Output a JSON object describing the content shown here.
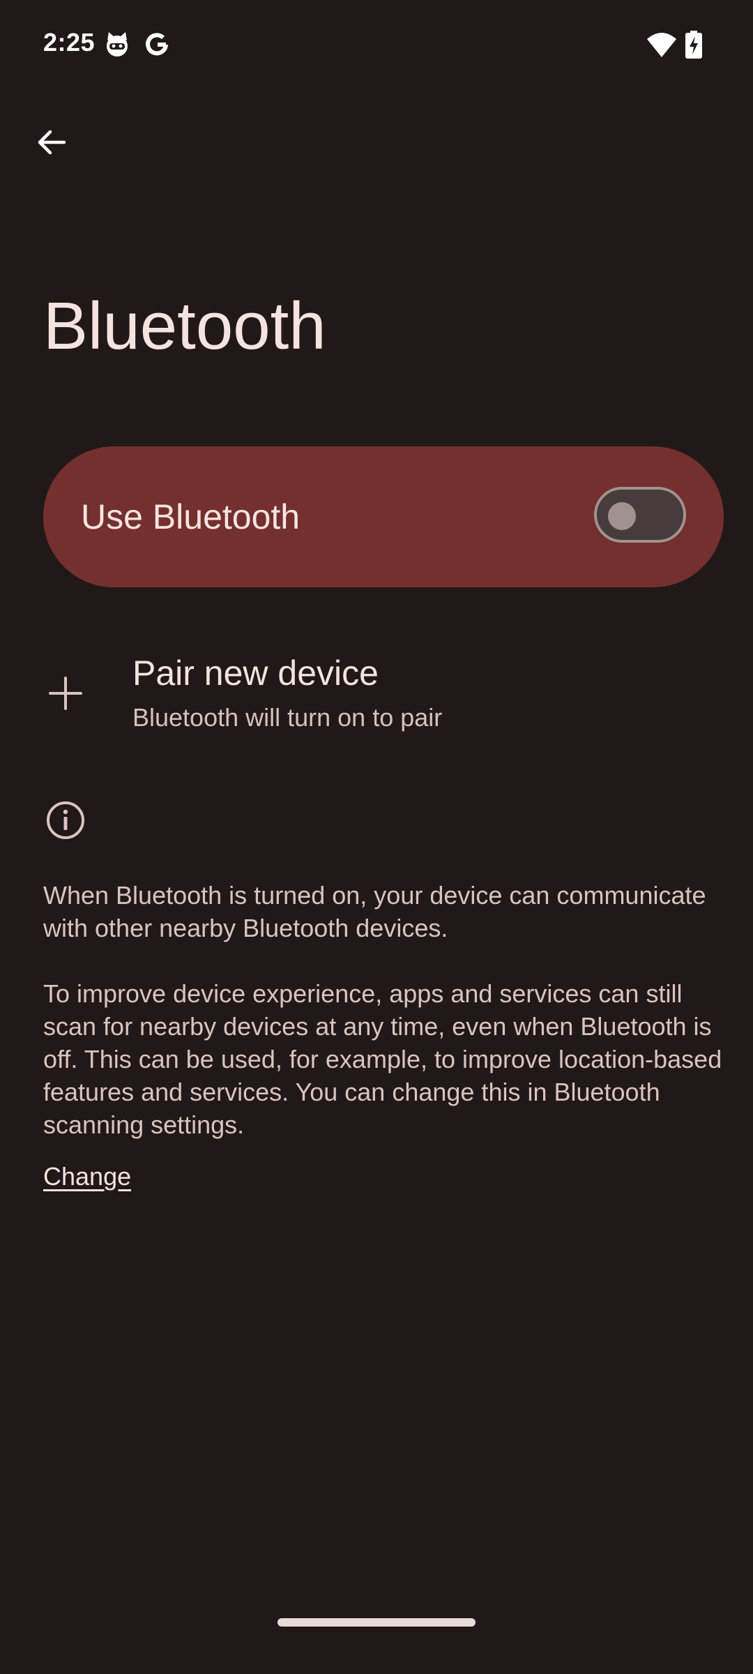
{
  "status_bar": {
    "time": "2:25",
    "left_icons": [
      "cat-face-icon",
      "google-g-icon"
    ],
    "right_icons": [
      "wifi-icon",
      "battery-charging-icon"
    ]
  },
  "nav": {
    "back_icon": "arrow-back-icon"
  },
  "page": {
    "title": "Bluetooth"
  },
  "main_switch": {
    "label": "Use Bluetooth",
    "state": "off"
  },
  "pair_device": {
    "icon": "plus-icon",
    "title": "Pair new device",
    "subtitle": "Bluetooth will turn on to pair"
  },
  "footer": {
    "icon": "info-icon",
    "paragraph_1": "When Bluetooth is turned on, your device can communicate with other nearby Bluetooth devices.",
    "paragraph_2": "To improve device experience, apps and services can still scan for nearby devices at any time, even when Bluetooth is off. This can be used, for example, to improve location-based features and services. You can change this in Bluetooth scanning settings.",
    "link_label": "Change"
  },
  "colors": {
    "background": "#211918",
    "switch_bar": "#73302e",
    "toggle_off": "#a2928f",
    "text_primary": "#f5e3e1",
    "text_secondary": "#d9c4c1"
  }
}
